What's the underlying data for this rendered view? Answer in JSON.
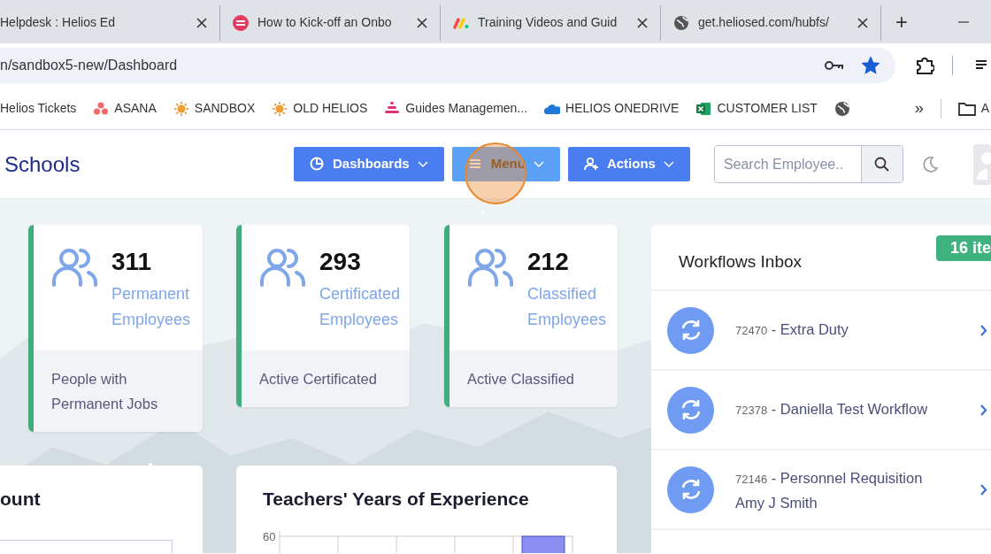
{
  "browser": {
    "tabs": [
      {
        "title": "Helpdesk : Helios Ed",
        "kind": "none",
        "selected": false
      },
      {
        "title": "How to Kick-off an Onbo",
        "kind": "circle",
        "selected": false
      },
      {
        "title": "Training Videos and Guid",
        "kind": "stripes",
        "selected": false
      },
      {
        "title": "get.heliosed.com/hubfs/",
        "kind": "globe",
        "selected": false
      }
    ],
    "new_tab": "+",
    "address": "n/sandbox5-new/Dashboard",
    "bookmarked": true,
    "bookmarks": [
      {
        "label": "Helios Tickets",
        "kind": "none"
      },
      {
        "label": "ASANA",
        "kind": "dots"
      },
      {
        "label": "SANDBOX",
        "kind": "sun"
      },
      {
        "label": "OLD HELIOS",
        "kind": "sun"
      },
      {
        "label": "Guides Managemen...",
        "kind": "stack"
      },
      {
        "label": "HELIOS ONEDRIVE",
        "kind": "cloud"
      },
      {
        "label": "CUSTOMER LIST",
        "kind": "sheet"
      },
      {
        "kind": "globe"
      }
    ],
    "more": "»",
    "folder": "A"
  },
  "app": {
    "title": "Schools",
    "nav": [
      {
        "label": "Dashboards",
        "kind": "pie",
        "hovered": false
      },
      {
        "label": "Menu",
        "kind": "bars",
        "hovered": true
      },
      {
        "label": "Actions",
        "kind": "user-plus",
        "hovered": false
      }
    ],
    "search": {
      "placeholder": "Search Employee.."
    }
  },
  "stats": [
    {
      "value": "311",
      "label": "Permanent Employees",
      "footer": "People with Permanent Jobs"
    },
    {
      "value": "293",
      "label": "Certificated Employees",
      "footer": "Active Certificated"
    },
    {
      "value": "212",
      "label": "Classified Employees",
      "footer": "Active Classified"
    }
  ],
  "workflows": {
    "title": "Workflows Inbox",
    "badge": "16 ite",
    "items": [
      {
        "id": "72470",
        "title": "- Extra Duty"
      },
      {
        "id": "72378",
        "title": "- Daniella Test Workflow"
      },
      {
        "id": "72146",
        "title": "- Personnel Requisition",
        "subtitle": "Amy J Smith"
      }
    ]
  },
  "panels": [
    {
      "title": "ount"
    },
    {
      "title": "Teachers' Years of Experience",
      "tick": "60"
    }
  ]
}
